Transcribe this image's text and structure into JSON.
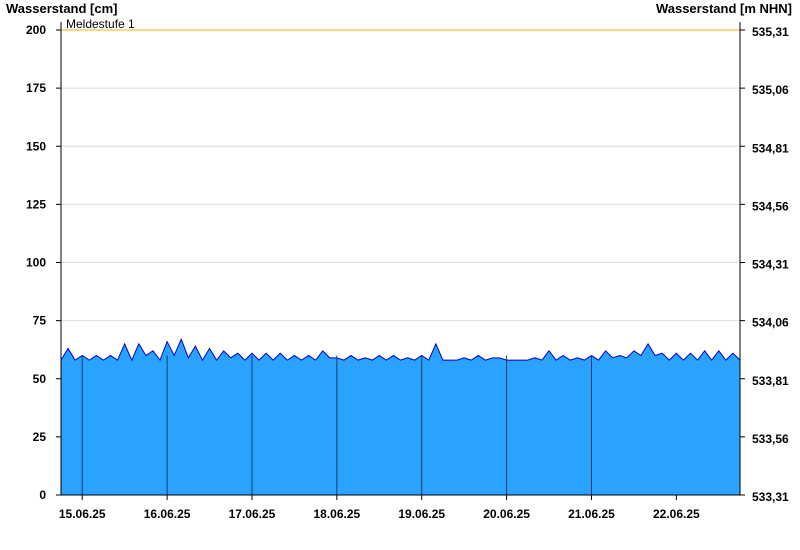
{
  "chart_data": {
    "type": "area",
    "left_axis": {
      "title": "Wasserstand [cm]",
      "ylim": [
        0,
        200
      ],
      "ticks": [
        0,
        25,
        50,
        75,
        100,
        125,
        150,
        175,
        200
      ],
      "tick_labels": [
        "0",
        "25",
        "50",
        "75",
        "100",
        "125",
        "150",
        "175",
        "200"
      ]
    },
    "right_axis": {
      "title": "Wasserstand [m NHN]",
      "tick_labels": [
        "533,31",
        "533,56",
        "533,81",
        "534,06",
        "534,31",
        "534,56",
        "534,81",
        "535,06",
        "535,31"
      ]
    },
    "x_axis": {
      "start_day": "14.06.25 18:00",
      "tick_labels": [
        "15.06.25",
        "16.06.25",
        "17.06.25",
        "18.06.25",
        "19.06.25",
        "20.06.25",
        "21.06.25",
        "22.06.25"
      ]
    },
    "reference_line": {
      "label": "Meldestufe 1",
      "value": 200,
      "color": "#f5c242"
    },
    "series": [
      {
        "fill_color": "#29a3ff",
        "stroke_color": "#0000cc",
        "x_hours": [
          0,
          2,
          4,
          6,
          8,
          10,
          12,
          14,
          16,
          18,
          20,
          22,
          24,
          26,
          28,
          30,
          32,
          34,
          36,
          38,
          40,
          42,
          44,
          46,
          48,
          50,
          52,
          54,
          56,
          58,
          60,
          62,
          64,
          66,
          68,
          70,
          72,
          74,
          76,
          78,
          80,
          82,
          84,
          86,
          88,
          90,
          92,
          94,
          96,
          98,
          100,
          102,
          104,
          106,
          108,
          110,
          112,
          114,
          116,
          118,
          120,
          122,
          124,
          126,
          128,
          130,
          132,
          134,
          136,
          138,
          140,
          142,
          144,
          146,
          148,
          150,
          152,
          154,
          156,
          158,
          160,
          162,
          164,
          166,
          168,
          170,
          172,
          174,
          176,
          178,
          180,
          182,
          184,
          186,
          188,
          190,
          192
        ],
        "values": [
          58,
          63,
          58,
          60,
          58,
          60,
          58,
          60,
          58,
          65,
          58,
          65,
          60,
          62,
          58,
          66,
          60,
          67,
          59,
          64,
          58,
          63,
          58,
          62,
          59,
          61,
          58,
          61,
          58,
          61,
          58,
          61,
          58,
          60,
          58,
          60,
          58,
          62,
          59,
          59,
          58,
          60,
          58,
          59,
          58,
          60,
          58,
          60,
          58,
          59,
          58,
          60,
          58,
          65,
          58,
          58,
          58,
          59,
          58,
          60,
          58,
          59,
          59,
          58,
          58,
          58,
          58,
          59,
          58,
          62,
          58,
          60,
          58,
          59,
          58,
          60,
          58,
          62,
          59,
          60,
          59,
          62,
          60,
          65,
          60,
          61,
          58,
          61,
          58,
          61,
          58,
          62,
          58,
          62,
          58,
          61,
          58
        ]
      }
    ]
  }
}
